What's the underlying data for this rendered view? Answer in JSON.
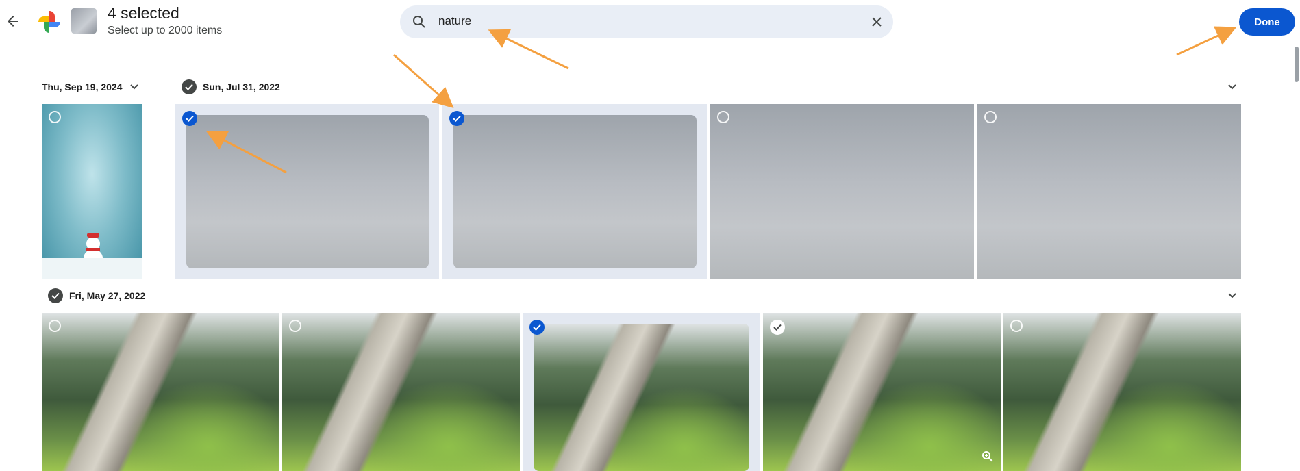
{
  "header": {
    "title": "4 selected",
    "subtitle": "Select up to 2000 items",
    "done_label": "Done"
  },
  "search": {
    "value": "nature"
  },
  "sections": [
    {
      "date": "Thu, Sep 19, 2024"
    },
    {
      "date": "Sun, Jul 31, 2022"
    },
    {
      "date": "Fri, May 27, 2022"
    }
  ],
  "colors": {
    "accent": "#0b57d0",
    "search_bg": "#e9eef6",
    "selected_tile_bg": "#e3e8f1",
    "annotation_arrow": "#f4a040"
  },
  "icons": [
    "back-arrow-icon",
    "google-photos-logo",
    "search-icon",
    "close-icon",
    "chevron-down-icon",
    "check-icon",
    "zoom-in-icon"
  ]
}
